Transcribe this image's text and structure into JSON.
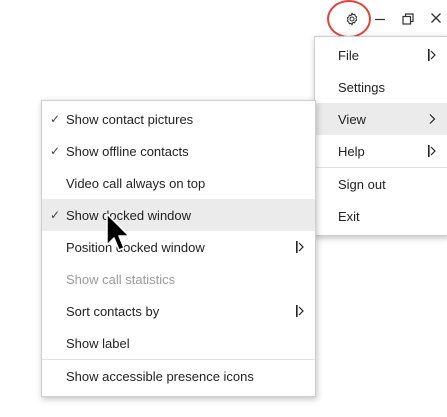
{
  "titlebar": {
    "icons": [
      "gear-icon",
      "minimize-icon",
      "restore-icon",
      "close-icon"
    ],
    "annotation_color": "#e0413c"
  },
  "main_menu": {
    "items": [
      {
        "label": "File",
        "has_submenu": true
      },
      {
        "label": "Settings",
        "has_submenu": false
      },
      {
        "label": "View",
        "has_submenu": true,
        "highlighted": true
      },
      {
        "label": "Help",
        "has_submenu": true
      },
      {
        "label": "Sign out",
        "has_submenu": false
      },
      {
        "label": "Exit",
        "has_submenu": false
      }
    ]
  },
  "view_submenu": {
    "items": [
      {
        "label": "Show contact pictures",
        "checked": true
      },
      {
        "label": "Show offline contacts",
        "checked": true
      },
      {
        "label": "Video call always on top",
        "checked": false
      },
      {
        "label": "Show docked window",
        "checked": true,
        "highlighted": true
      },
      {
        "label": "Position docked window",
        "has_submenu": true
      },
      {
        "label": "Show call statistics",
        "disabled": true
      },
      {
        "label": "Sort contacts by",
        "has_submenu": true
      },
      {
        "label": "Show label",
        "checked": false
      },
      {
        "label": "Show accessible presence icons",
        "checked": false
      }
    ]
  },
  "colors": {
    "highlight": "#ebebeb",
    "disabled_text": "#9a9a9a"
  }
}
